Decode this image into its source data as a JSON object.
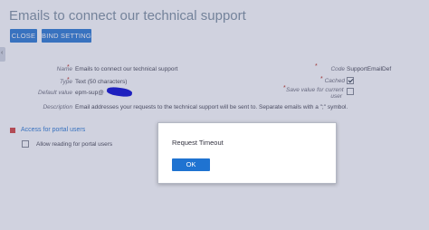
{
  "page": {
    "title": "Emails to connect our technical support"
  },
  "toolbar": {
    "close_label": "CLOSE",
    "bind_setting_label": "BIND SETTING"
  },
  "form": {
    "name": {
      "label": "Name",
      "value": "Emails to connect our technical support"
    },
    "type": {
      "label": "Type",
      "value": "Text (50 characters)"
    },
    "default_value": {
      "label": "Default value",
      "value": "epm-sup@"
    },
    "description": {
      "label": "Description",
      "value": "Email addresses your requests to the technical support will be sent to. Separate emails with a \";\" symbol."
    },
    "code": {
      "label": "Code",
      "value": "SupportEmailDef"
    },
    "cached": {
      "label": "Cached",
      "checked": true
    },
    "save_value": {
      "label_line1": "Save value for current",
      "label_line2": "user",
      "checked": false
    }
  },
  "section": {
    "title": "Access for portal users",
    "allow_reading": {
      "label": "Allow reading for portal users",
      "checked": false
    }
  },
  "dialog": {
    "message": "Request Timeout",
    "ok_label": "OK"
  },
  "colors": {
    "accent": "#3d84d6",
    "ok_button": "#1f73d1",
    "section_marker": "#d9534f",
    "overlay": "rgba(40, 50, 110, 0.22)"
  }
}
